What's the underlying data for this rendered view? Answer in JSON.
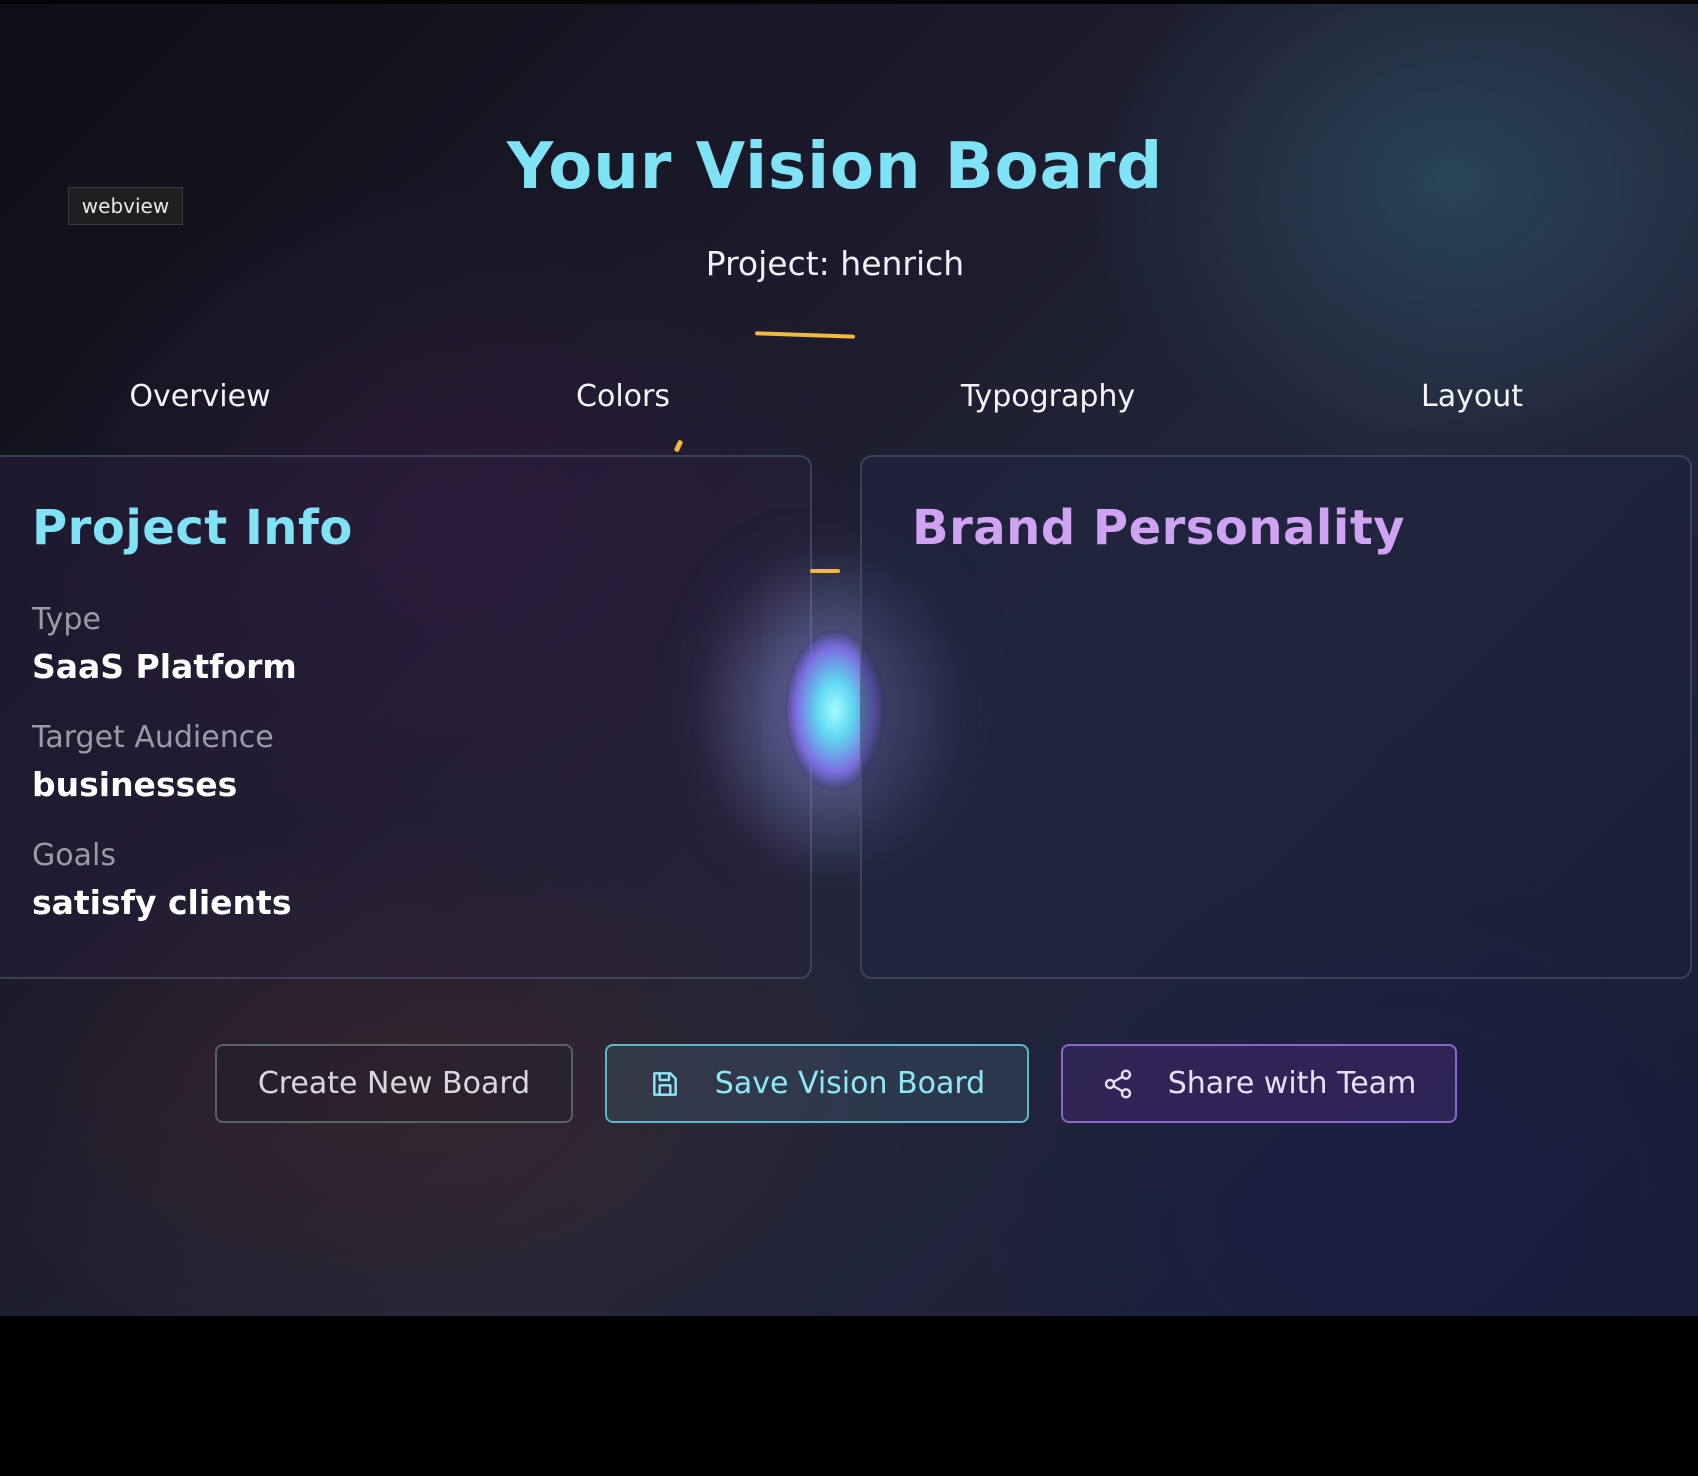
{
  "webview_tag": "webview",
  "header": {
    "title": "Your Vision Board",
    "subtitle": "Project: henrich"
  },
  "tabs": [
    {
      "label": "Overview"
    },
    {
      "label": "Colors"
    },
    {
      "label": "Typography"
    },
    {
      "label": "Layout"
    }
  ],
  "project_info": {
    "title": "Project Info",
    "fields": [
      {
        "label": "Type",
        "value": "SaaS Platform"
      },
      {
        "label": "Target Audience",
        "value": "businesses"
      },
      {
        "label": "Goals",
        "value": "satisfy clients"
      }
    ]
  },
  "brand_personality": {
    "title": "Brand Personality"
  },
  "actions": {
    "create_label": "Create New Board",
    "save_label": "Save Vision Board",
    "share_label": "Share with Team",
    "save_icon": "save-icon",
    "share_icon": "share-icon"
  },
  "colors": {
    "accent_cyan": "#7fe3f5",
    "accent_purple": "#cfa3f2",
    "accent_gold": "#f2b93b"
  }
}
